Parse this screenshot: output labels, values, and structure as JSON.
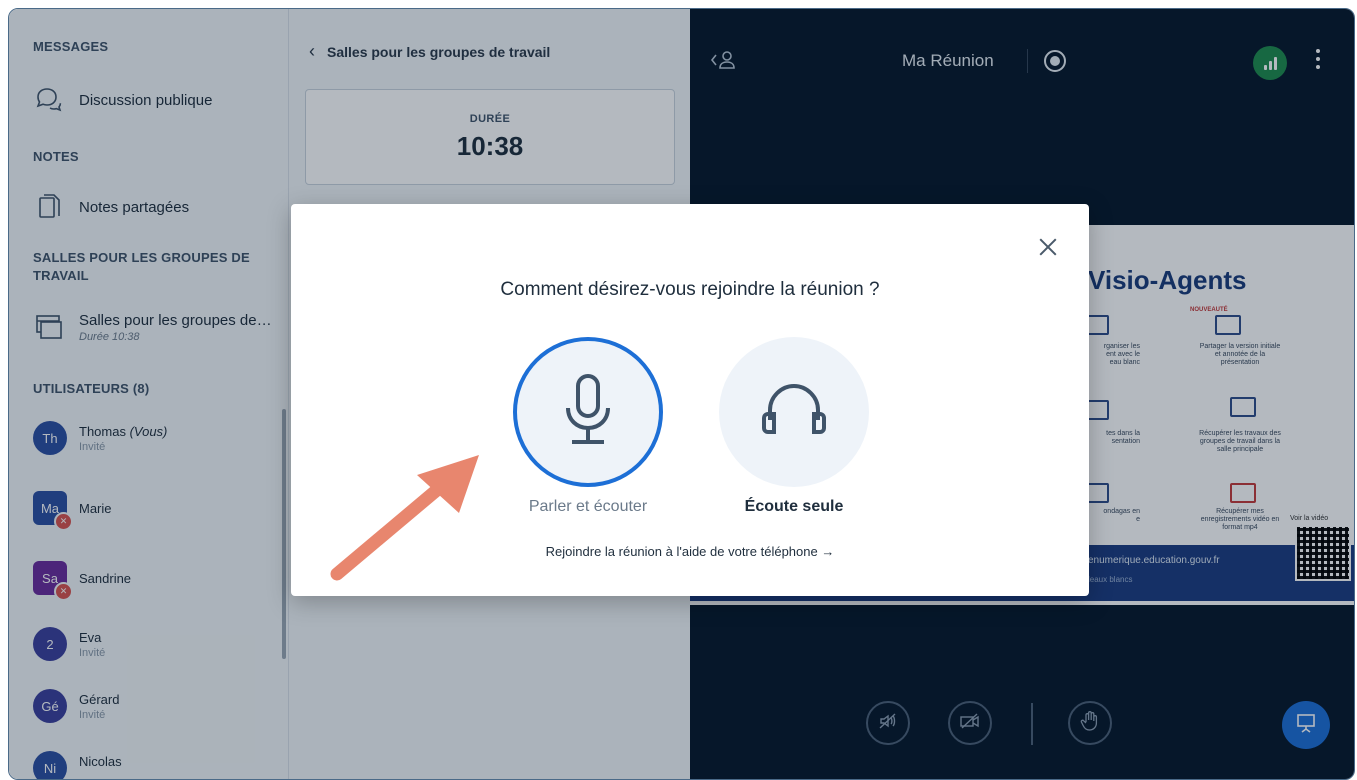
{
  "sidebar": {
    "messages_title": "MESSAGES",
    "public_chat": "Discussion publique",
    "notes_title": "NOTES",
    "shared_notes": "Notes partagées",
    "breakout_title": "SALLES POUR LES GROUPES DE TRAVAIL",
    "breakout_item": "Salles pour les groupes de…",
    "breakout_duration": "Durée 10:38",
    "users_title": "UTILISATEURS (8)",
    "users": [
      {
        "initials": "Th",
        "name": "Thomas",
        "suffix": " (Vous)",
        "role": "Invité",
        "color": "#2c4fa3"
      },
      {
        "initials": "Ma",
        "name": "Marie",
        "suffix": "",
        "role": "",
        "color": "#2c4fa3"
      },
      {
        "initials": "Sa",
        "name": "Sandrine",
        "suffix": "",
        "role": "",
        "color": "#6b2c9c"
      },
      {
        "initials": "2",
        "name": "Eva",
        "suffix": "",
        "role": "Invité",
        "color": "#3b3f9c"
      },
      {
        "initials": "Gé",
        "name": "Gérard",
        "suffix": "",
        "role": "Invité",
        "color": "#3b3f9c"
      },
      {
        "initials": "Ni",
        "name": "Nicolas",
        "suffix": "",
        "role": "",
        "color": "#2c4fa3"
      }
    ]
  },
  "panel": {
    "header": "Salles pour les groupes de travail",
    "duration_label": "DURÉE",
    "duration_value": "10:38"
  },
  "main": {
    "meeting_title": "Ma Réunion",
    "slide_title": "Visio-Agents",
    "slide_new_badge": "NOUVEAUTÉ",
    "slide_texts": [
      "rganiser les\nent avec le\neau blanc",
      "Partager la version initiale\net annotée de la\nprésentation",
      "tes dans la\nsentation",
      "Récupérer les travaux des\ngroupes de travail dans la\nsalle principale",
      "ondagas en\ne",
      "Récupérer mes\nenregistrements vidéo en\nformat mp4"
    ],
    "slide_url": "enumerique.education.gouv.fr",
    "slide_sub": "leaux blancs",
    "qr_label": "Voir la vidéo"
  },
  "modal": {
    "title": "Comment désirez-vous rejoindre la réunion ?",
    "option_mic": "Parler et écouter",
    "option_listen": "Écoute seule",
    "phone_link": "Rejoindre la réunion à l'aide de votre téléphone →"
  },
  "colors": {
    "accent": "#1d6fd6",
    "main_bg": "#06172a",
    "connection": "#1f8b4c",
    "arrow": "#e8866e"
  }
}
